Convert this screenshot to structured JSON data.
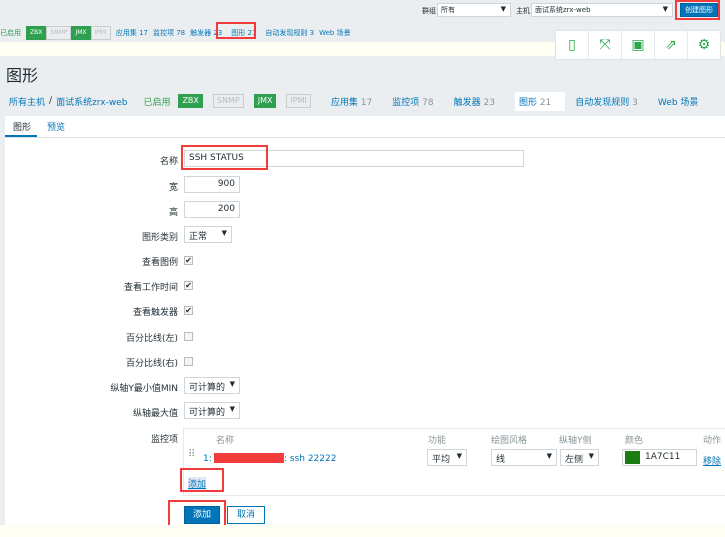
{
  "top": {
    "group_label": "群组",
    "group_value": "所有",
    "host_label": "主机",
    "host_value": "面试系统zrx-web",
    "create_button": "创建图形"
  },
  "subnav": {
    "enabled": "已启用",
    "zbx": "ZBX",
    "snmp": "SNMP",
    "jmx": "JMX",
    "ipmi": "IPMI",
    "apps": "应用集 17",
    "items": "监控项 78",
    "triggers": "触发器 23",
    "graphs": "图形 21",
    "discovery": "自动发现规则 3",
    "web": "Web 场景"
  },
  "icons": [
    "mobile-icon",
    "fullscreen-icon",
    "save-icon",
    "share-icon",
    "gear-icon"
  ],
  "page_title": "图形",
  "breadcrumb": {
    "all_hosts": "所有主机",
    "sep": "/",
    "host": "面试系统zrx-web"
  },
  "nav": {
    "enabled": "已启用",
    "zbx": "ZBX",
    "snmp": "SNMP",
    "jmx": "JMX",
    "ipmi": "IPMI",
    "apps_label": "应用集",
    "apps_count": "17",
    "items_label": "监控项",
    "items_count": "78",
    "triggers_label": "触发器",
    "triggers_count": "23",
    "graphs_label": "图形",
    "graphs_count": "21",
    "discovery_label": "自动发现规则",
    "discovery_count": "3",
    "web": "Web 场景"
  },
  "tabs": {
    "graph": "图形",
    "preview": "预览"
  },
  "form": {
    "name_label": "名称",
    "name_value": "SSH STATUS",
    "width_label": "宽",
    "width_value": "900",
    "height_label": "高",
    "height_value": "200",
    "type_label": "图形类别",
    "type_value": "正常",
    "legend_label": "查看图例",
    "legend_checked": true,
    "worktime_label": "查看工作时间",
    "worktime_checked": true,
    "triggers_label": "查看触发器",
    "triggers_checked": true,
    "pleft_label": "百分比线(左)",
    "pleft_checked": false,
    "pright_label": "百分比线(右)",
    "pright_checked": false,
    "ymin_label": "纵轴Y最小值MIN",
    "ymin_value": "可计算的",
    "ymax_label": "纵轴最大值",
    "ymax_value": "可计算的",
    "items_label": "监控项"
  },
  "items_table": {
    "headers": {
      "name": "名称",
      "func": "功能",
      "style": "绘图风格",
      "yaxis": "纵轴Y侧",
      "color": "颜色",
      "action": "动作"
    },
    "rows": [
      {
        "index": "1:",
        "name_suffix": ": ssh 22222",
        "func": "平均",
        "style": "线",
        "yaxis": "左侧",
        "color": "1A7C11",
        "action": "移除"
      }
    ],
    "add_link": "添加"
  },
  "buttons": {
    "add": "添加",
    "cancel": "取消"
  },
  "colors": {
    "accent": "#0275b8",
    "item_color": "#1A7C11",
    "highlight": "#f23b3b"
  }
}
